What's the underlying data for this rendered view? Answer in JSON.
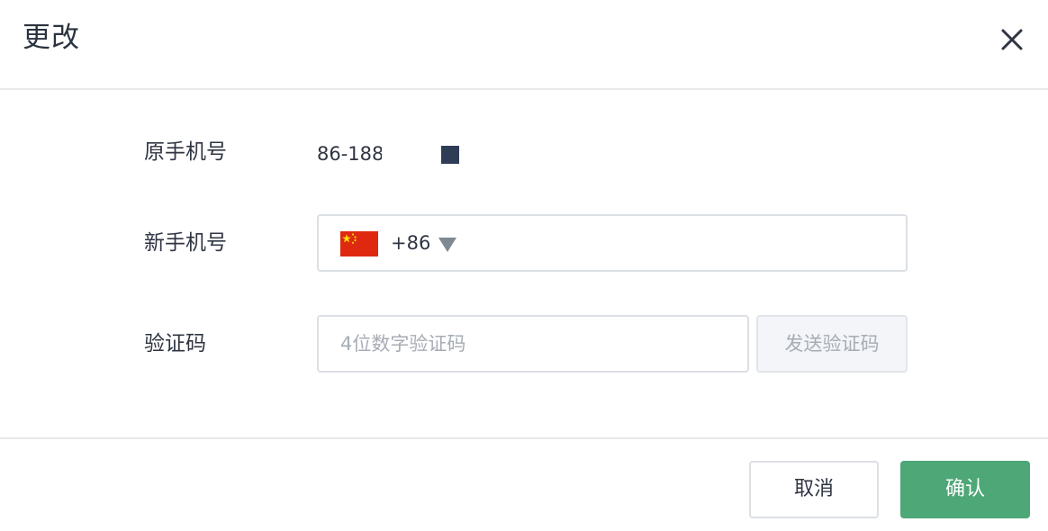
{
  "dialog": {
    "title": "更改"
  },
  "form": {
    "old_phone": {
      "label": "原手机号",
      "value": "86-188"
    },
    "new_phone": {
      "label": "新手机号",
      "country_code": "+86",
      "flag_icon": "china-flag-icon",
      "value": ""
    },
    "verification": {
      "label": "验证码",
      "placeholder": "4位数字验证码",
      "value": "",
      "send_button": "发送验证码"
    }
  },
  "footer": {
    "cancel_label": "取消",
    "confirm_label": "确认"
  },
  "colors": {
    "primary": "#4ea776",
    "text": "#2f3542",
    "muted": "#a7adb5",
    "border": "#dcdfe4",
    "mask": "#2e3d55"
  }
}
